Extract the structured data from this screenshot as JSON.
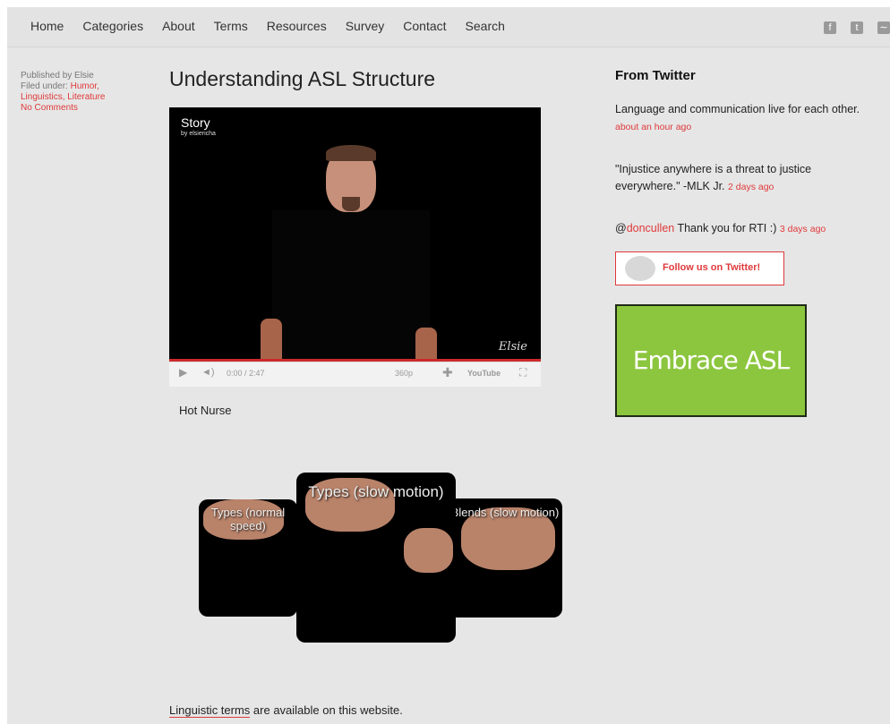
{
  "nav": {
    "items": [
      "Home",
      "Categories",
      "About",
      "Terms",
      "Resources",
      "Survey",
      "Contact",
      "Search"
    ],
    "social_icons": [
      "facebook-icon",
      "twitter-icon",
      "rss-icon"
    ]
  },
  "post_meta": {
    "published_by": "Published by Elsie",
    "filed_under_label": "Filed under:",
    "cat1": "Humor,",
    "cat2": "Linguistics, Literature",
    "comments": "No Comments"
  },
  "post": {
    "title": "Understanding ASL Structure",
    "video": {
      "title": "Story",
      "subtitle": "by elsiericha",
      "time": "0:00 / 2:47",
      "quality": "360p",
      "brand": "YouTube",
      "signature": "Elsie"
    },
    "caption": "Hot Nurse",
    "carousel": [
      {
        "label": "Types (normal speed)"
      },
      {
        "label": "Types (slow motion)"
      },
      {
        "label": "Blends (slow motion)"
      }
    ],
    "footer_link": "Linguistic terms",
    "footer_rest": " are available on this website."
  },
  "sidebar": {
    "heading": "From Twitter",
    "tweets": [
      {
        "text": "Language and communication live for each other.",
        "time": "about an hour ago"
      },
      {
        "text": "\"Injustice anywhere is a threat to justice everywhere.\" -MLK Jr.",
        "time": "2 days ago"
      },
      {
        "at": "@",
        "handle": "doncullen",
        "text": " Thank you for RTI :)",
        "time": "3 days ago"
      }
    ],
    "follow_label": "Follow us on Twitter!",
    "banner": "Embrace ASL"
  },
  "colors": {
    "accent": "#e0393b",
    "banner": "#8cc63f",
    "background": "#e6e6e6"
  }
}
